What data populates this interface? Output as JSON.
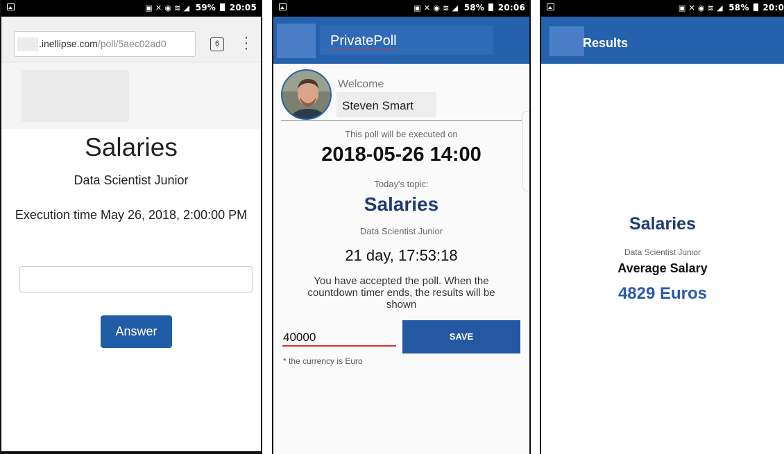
{
  "screen1": {
    "status_right": "59%",
    "status_time": "20:05",
    "url_host": ".inellipse.com",
    "url_path": "/poll/5aec02ad0",
    "tabs_count": "6",
    "title": "Salaries",
    "subtitle": "Data Scientist Junior",
    "execution_text": "Execution time May 26, 2018, 2:00:00 PM",
    "answer_button": "Answer"
  },
  "screen2": {
    "status_right": "58%",
    "status_time": "20:06",
    "app_title": "PrivatePoll",
    "welcome": "Welcome",
    "user_name": "Steven Smart",
    "execution_label": "This poll will be executed on",
    "execution_date": "2018-05-26 14:00",
    "topic_label": "Today's topic:",
    "topic": "Salaries",
    "subtitle": "Data Scientist Junior",
    "countdown": "21 day, 17:53:18",
    "accepted_text": "You have accepted the poll. When the countdown timer ends, the results will be shown",
    "amount_value": "40000",
    "save_button": "SAVE",
    "currency_note": "* the currency is Euro"
  },
  "screen3": {
    "status_right": "58%",
    "status_time": "20:0",
    "app_title": "Results",
    "topic": "Salaries",
    "subtitle": "Data Scientist Junior",
    "average_label": "Average Salary",
    "average_value": "4829 Euros"
  },
  "colors": {
    "app_bar": "#2661ad",
    "button_blue": "#215ca6",
    "topic_navy": "#1f3c72",
    "input_underline": "#d32f2f"
  },
  "icons": {
    "status_left": "picture-icon",
    "browser_tabs": "tabs-icon",
    "browser_menu": "more-vert-icon"
  }
}
